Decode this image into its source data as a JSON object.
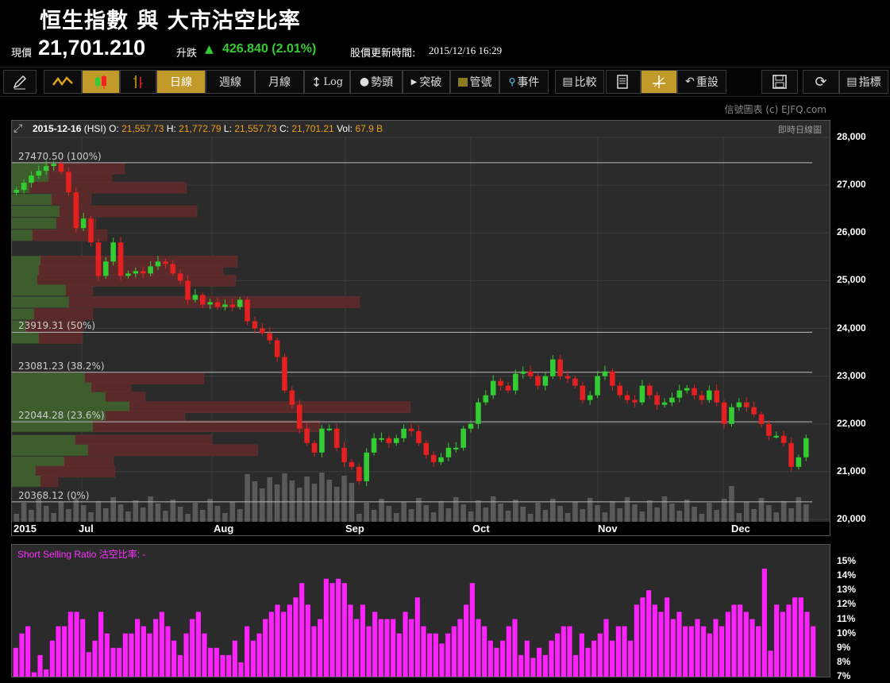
{
  "title": "恒生指數 與 大市沽空比率",
  "quote": {
    "price_label": "現價",
    "price": "21,701.210",
    "change_label": "升跌",
    "change": "426.840 (2.01%)",
    "update_label": "股價更新時間:",
    "update_time": "2015/12/16 16:29"
  },
  "toolbar": {
    "items": [
      "日線",
      "週線",
      "月線",
      "Log",
      "勢頭",
      "突破",
      "管號",
      "事件",
      "比較",
      "重設",
      "指標"
    ]
  },
  "copyright": "信號圖表 (c) EJFQ.com",
  "ohlc": {
    "date": "2015-12-16",
    "symbol": "(HSI)",
    "o_label": "O:",
    "o": "21,557.73",
    "h_label": "H:",
    "h": "21,772.79",
    "l_label": "L:",
    "l": "21,557.73",
    "c_label": "C:",
    "c": "21,701.21",
    "vol_label": "Vol:",
    "vol": "67.9 B",
    "chart_mode": "即時日線圖"
  },
  "fib_labels": [
    "27470.50 (100%)",
    "23919.31 (50%)",
    "23081.23 (38.2%)",
    "22044.28 (23.6%)",
    "20368.12 (0%)"
  ],
  "sub_title": "Short Selling Ratio 沽空比率: -",
  "colors": {
    "up": "#33cc33",
    "down": "#e52020",
    "ssr": "#ff22ff",
    "accent": "#c29a2a"
  },
  "chart_data": [
    {
      "type": "candlestick",
      "title": "恒生指數",
      "x_ticks": [
        "2015",
        "Jul",
        "Aug",
        "Sep",
        "Oct",
        "Nov",
        "Dec"
      ],
      "y_ticks": [
        "28,000",
        "27,000",
        "26,000",
        "25,000",
        "24,000",
        "23,000",
        "22,000",
        "21,000",
        "20,000"
      ],
      "ylim": [
        20000,
        28000
      ],
      "fibonacci": [
        27470.5,
        23919.31,
        23081.23,
        22044.28,
        20368.12
      ],
      "closes": [
        26900,
        27050,
        27200,
        27300,
        27400,
        27450,
        27280,
        26850,
        26100,
        26300,
        25800,
        25100,
        25400,
        25800,
        25100,
        25150,
        25200,
        25150,
        25300,
        25400,
        25350,
        25150,
        25000,
        24600,
        24700,
        24500,
        24550,
        24450,
        24500,
        24450,
        24600,
        24150,
        24000,
        23900,
        23750,
        23400,
        22700,
        22400,
        21900,
        21600,
        21400,
        21900,
        21900,
        21500,
        21200,
        21100,
        20800,
        21400,
        21700,
        21700,
        21600,
        21700,
        21900,
        21850,
        21600,
        21350,
        21200,
        21300,
        21500,
        21500,
        21900,
        22000,
        22450,
        22600,
        22900,
        22800,
        22700,
        23050,
        23100,
        23000,
        22800,
        23000,
        23350,
        23000,
        22950,
        22800,
        22500,
        22600,
        23000,
        23100,
        22800,
        22600,
        22500,
        22450,
        22800,
        22600,
        22400,
        22450,
        22550,
        22700,
        22750,
        22600,
        22500,
        22700,
        22450,
        22000,
        22350,
        22450,
        22350,
        22200,
        22000,
        21750,
        21750,
        21600,
        21100,
        21300,
        21701
      ]
    },
    {
      "type": "bar",
      "title": "Short Selling Ratio 沽空比率",
      "y_ticks": [
        "15%",
        "14%",
        "13%",
        "12%",
        "11%",
        "10%",
        "9%",
        "8%",
        "7%"
      ],
      "ylim": [
        7,
        15
      ],
      "values": [
        9.0,
        10.0,
        10.5,
        7.3,
        8.5,
        7.5,
        9.5,
        10.5,
        10.5,
        11.5,
        11.5,
        11.0,
        8.7,
        9.5,
        11.5,
        10.0,
        9.0,
        9.0,
        10.0,
        10.0,
        11.0,
        10.5,
        10.0,
        11.0,
        11.5,
        10.5,
        9.5,
        8.5,
        10.0,
        11.0,
        11.5,
        10.0,
        9.0,
        9.0,
        8.5,
        8.5,
        9.5,
        8.0,
        10.5,
        9.5,
        10.0,
        11.0,
        11.5,
        12.0,
        11.5,
        12.0,
        12.5,
        13.5,
        12.0,
        10.5,
        11.0,
        13.8,
        13.5,
        13.8,
        13.5,
        12.0,
        11.0,
        12.0,
        10.5,
        11.5,
        11.0,
        11.0,
        11.0,
        10.0,
        11.5,
        11.0,
        12.5,
        10.5,
        10.0,
        10.0,
        9.3,
        10.0,
        10.5,
        11.0,
        12.0,
        13.5,
        11.0,
        10.5,
        9.5,
        9.0,
        9.5,
        10.5,
        11.0,
        8.5,
        9.5,
        8.3,
        9.0,
        8.5,
        9.5,
        10.0,
        10.5,
        10.5,
        8.5,
        10.0,
        9.0,
        9.5,
        10.0,
        11.0,
        9.5,
        10.5,
        10.5,
        9.5,
        12.0,
        12.5,
        13.0,
        12.0,
        11.5,
        12.5,
        11.0,
        11.5,
        10.5,
        10.5,
        11.0,
        10.5,
        10.0,
        11.0,
        10.5,
        11.5,
        12.0,
        12.0,
        11.5,
        11.0,
        10.5,
        14.5,
        8.8,
        12.0,
        11.5,
        12.0,
        12.5,
        12.5,
        11.5,
        10.5
      ]
    }
  ]
}
